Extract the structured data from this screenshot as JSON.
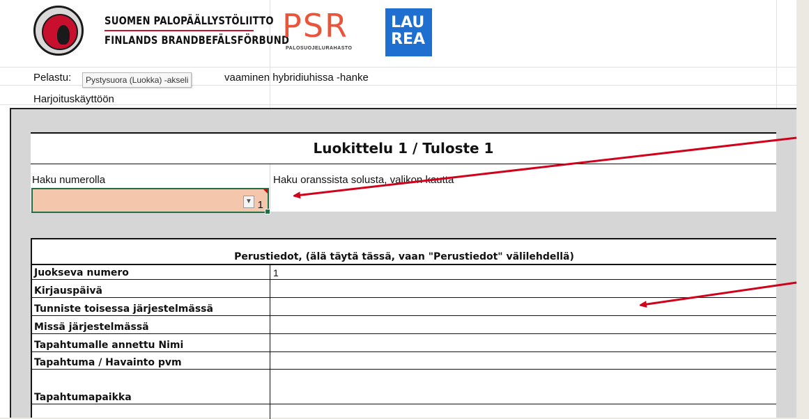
{
  "header": {
    "org_line1": "SUOMEN PALOPÄÄLLYSTÖLIITTO",
    "org_line2": "FINLANDS BRANDBEFÄLSFÖRBUND",
    "psr_logo": "PSR",
    "psr_subtitle": "PALOSUOJELURAHASTO",
    "laurea_line1": "LAU",
    "laurea_line2": "REA"
  },
  "sheet": {
    "row1_prefix": "Pelastu:",
    "row1_suffix": "vaaminen hybridiuhissa -hanke",
    "row2_text": "Harjoituskäyttöön",
    "tooltip": "Pystysuora (Luokka) -akseli"
  },
  "title_table": {
    "title": "Luokittelu 1 / Tuloste 1",
    "left_label": "Haku numerolla",
    "right_label": "Haku oranssista solusta, valikon kautta",
    "selected_value": "1",
    "selected_fill": "#f4c7ac"
  },
  "perustiedot": {
    "header": "Perustiedot, (älä täytä tässä, vaan \"Perustiedot\" välilehdellä)",
    "rows": [
      {
        "label": "Juokseva numero",
        "value": "1"
      },
      {
        "label": "Kirjauspäivä",
        "value": ""
      },
      {
        "label": "Tunniste toisessa järjestelmässä",
        "value": ""
      },
      {
        "label": "Missä järjestelmässä",
        "value": ""
      },
      {
        "label": "Tapahtumalle annettu Nimi",
        "value": ""
      },
      {
        "label": "Tapahtuma / Havainto pvm",
        "value": ""
      },
      {
        "label": "Tapahtumapaikka",
        "value": ""
      },
      {
        "label": "",
        "value": ""
      }
    ]
  },
  "colors": {
    "arrow": "#d0021b",
    "laurea_blue": "#1f6fd1",
    "psr_orange": "#e8553b"
  }
}
